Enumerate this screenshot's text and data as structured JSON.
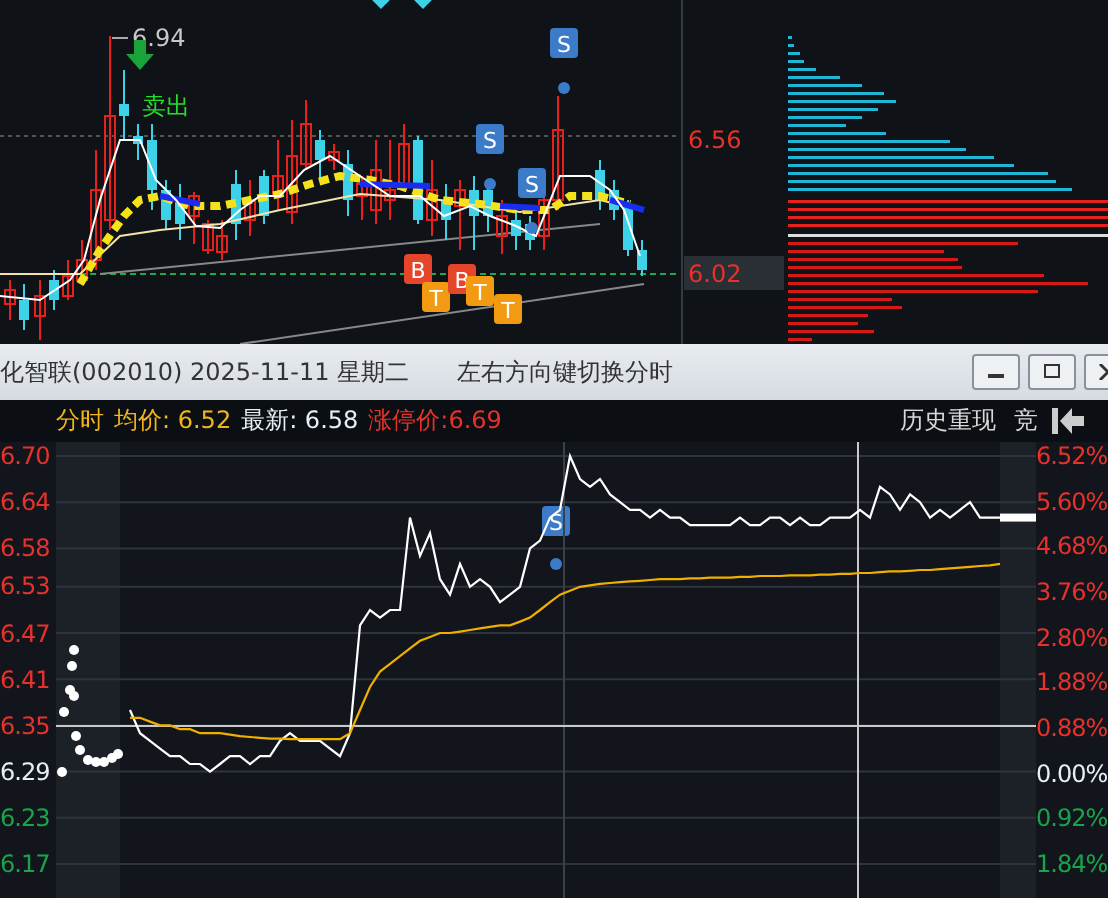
{
  "kline": {
    "high_label": "6.94",
    "signal_text": "卖出",
    "markers": [
      {
        "kind": "sell",
        "label": "S"
      },
      {
        "kind": "sell",
        "label": "S"
      },
      {
        "kind": "sell",
        "label": "S"
      },
      {
        "kind": "buy",
        "label": "B"
      },
      {
        "kind": "t",
        "label": "T"
      },
      {
        "kind": "buy",
        "label": "B"
      },
      {
        "kind": "t",
        "label": "T"
      },
      {
        "kind": "t",
        "label": "T"
      }
    ],
    "price_labels": [
      {
        "label": "6.56",
        "kind": "grid"
      },
      {
        "label": "6.02",
        "kind": "current"
      }
    ]
  },
  "title_bar": {
    "title": "化智联(002010) 2025-11-11 星期二",
    "hint": "左右方向键切换分时"
  },
  "info_bar": {
    "mode": "分时",
    "average": "均价: 6.52",
    "latest": "最新: 6.58",
    "limit_up": "涨停价:6.69",
    "history": "历史重现",
    "auction": "竞"
  },
  "intraday": {
    "markers": [
      {
        "kind": "sell",
        "label": "S"
      }
    ],
    "chart_data": {
      "type": "line",
      "ylim": [
        6.17,
        6.7
      ],
      "grid": true,
      "yticks": [
        {
          "value": 6.7,
          "label": "6.70"
        },
        {
          "value": 6.64,
          "label": "6.64"
        },
        {
          "value": 6.58,
          "label": "6.58"
        },
        {
          "value": 6.53,
          "label": "6.53"
        },
        {
          "value": 6.47,
          "label": "6.47"
        },
        {
          "value": 6.41,
          "label": "6.41"
        },
        {
          "value": 6.35,
          "label": "6.35"
        },
        {
          "value": 6.29,
          "label": "6.29"
        },
        {
          "value": 6.23,
          "label": "6.23"
        },
        {
          "value": 6.17,
          "label": "6.17"
        }
      ],
      "series": [
        {
          "color": "#ffffff",
          "values": [
            6.37,
            6.34,
            6.33,
            6.32,
            6.31,
            6.31,
            6.3,
            6.3,
            6.29,
            6.3,
            6.31,
            6.31,
            6.3,
            6.31,
            6.31,
            6.33,
            6.34,
            6.33,
            6.33,
            6.33,
            6.32,
            6.31,
            6.34,
            6.48,
            6.5,
            6.49,
            6.5,
            6.5,
            6.62,
            6.57,
            6.6,
            6.54,
            6.52,
            6.56,
            6.53,
            6.54,
            6.53,
            6.51,
            6.52,
            6.53,
            6.58,
            6.59,
            6.62,
            6.63,
            6.7,
            6.67,
            6.66,
            6.67,
            6.65,
            6.64,
            6.63,
            6.63,
            6.62,
            6.63,
            6.62,
            6.62,
            6.61,
            6.61,
            6.61,
            6.61,
            6.61,
            6.62,
            6.61,
            6.61,
            6.62,
            6.62,
            6.61,
            6.62,
            6.61,
            6.61,
            6.62,
            6.62,
            6.62,
            6.63,
            6.62,
            6.66,
            6.65,
            6.63,
            6.65,
            6.64,
            6.62,
            6.63,
            6.62,
            6.63,
            6.64,
            6.62,
            6.62,
            6.62
          ]
        },
        {
          "color": "#f0b000",
          "values": [
            6.36,
            6.36,
            6.355,
            6.35,
            6.35,
            6.345,
            6.345,
            6.34,
            6.34,
            6.34,
            6.338,
            6.336,
            6.335,
            6.334,
            6.333,
            6.333,
            6.332,
            6.332,
            6.332,
            6.332,
            6.332,
            6.332,
            6.34,
            6.37,
            6.4,
            6.42,
            6.43,
            6.44,
            6.45,
            6.46,
            6.465,
            6.47,
            6.47,
            6.472,
            6.474,
            6.476,
            6.478,
            6.48,
            6.48,
            6.485,
            6.49,
            6.5,
            6.51,
            6.52,
            6.525,
            6.53,
            6.532,
            6.534,
            6.535,
            6.536,
            6.537,
            6.538,
            6.539,
            6.54,
            6.54,
            6.54,
            6.541,
            6.541,
            6.542,
            6.542,
            6.542,
            6.543,
            6.543,
            6.544,
            6.544,
            6.544,
            6.545,
            6.545,
            6.545,
            6.546,
            6.546,
            6.547,
            6.547,
            6.548,
            6.548,
            6.549,
            6.55,
            6.55,
            6.551,
            6.552,
            6.552,
            6.553,
            6.554,
            6.555,
            6.556,
            6.557,
            6.558,
            6.56
          ]
        }
      ]
    },
    "percent_labels": [
      {
        "label": "6.52%",
        "kind": "up"
      },
      {
        "label": "5.60%",
        "kind": "up"
      },
      {
        "label": "4.68%",
        "kind": "up"
      },
      {
        "label": "3.76%",
        "kind": "up"
      },
      {
        "label": "2.80%",
        "kind": "up"
      },
      {
        "label": "1.88%",
        "kind": "up"
      },
      {
        "label": "0.88%",
        "kind": "up"
      },
      {
        "label": "0.00%",
        "kind": "flat"
      },
      {
        "label": "0.92%",
        "kind": "down"
      },
      {
        "label": "1.84%",
        "kind": "down"
      }
    ]
  }
}
